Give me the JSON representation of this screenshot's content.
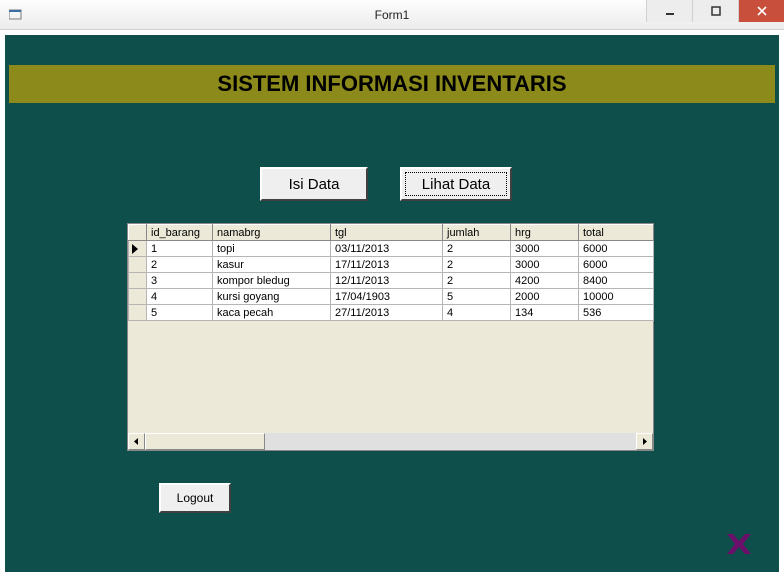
{
  "window": {
    "title": "Form1"
  },
  "banner": {
    "title": "SISTEM INFORMASI INVENTARIS"
  },
  "buttons": {
    "isi_data": "Isi Data",
    "lihat_data": "Lihat Data",
    "logout": "Logout"
  },
  "chart_data": {
    "type": "table",
    "columns": [
      "id_barang",
      "namabrg",
      "tgl",
      "jumlah",
      "hrg",
      "total"
    ],
    "rows": [
      {
        "id_barang": "1",
        "namabrg": "topi",
        "tgl": "03/11/2013",
        "jumlah": "2",
        "hrg": "3000",
        "total": "6000"
      },
      {
        "id_barang": "2",
        "namabrg": "kasur",
        "tgl": "17/11/2013",
        "jumlah": "2",
        "hrg": "3000",
        "total": "6000"
      },
      {
        "id_barang": "3",
        "namabrg": "kompor bledug",
        "tgl": "12/11/2013",
        "jumlah": "2",
        "hrg": "4200",
        "total": "8400"
      },
      {
        "id_barang": "4",
        "namabrg": "kursi goyang",
        "tgl": "17/04/1903",
        "jumlah": "5",
        "hrg": "2000",
        "total": "10000"
      },
      {
        "id_barang": "5",
        "namabrg": "kaca pecah",
        "tgl": "27/11/2013",
        "jumlah": "4",
        "hrg": "134",
        "total": "536"
      }
    ]
  }
}
